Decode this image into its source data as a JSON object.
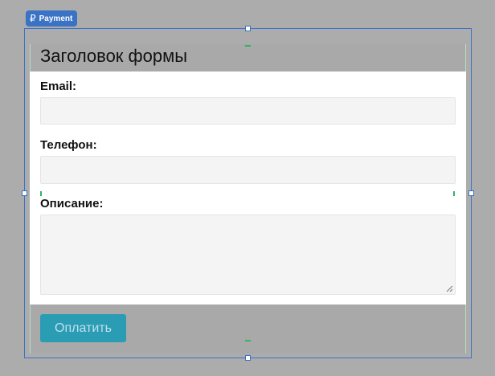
{
  "component": {
    "badge_label": "Payment",
    "badge_icon": "ruble-icon"
  },
  "form": {
    "title": "Заголовок формы",
    "fields": [
      {
        "label": "Email:",
        "value": "",
        "type": "text"
      },
      {
        "label": "Телефон:",
        "value": "",
        "type": "text"
      },
      {
        "label": "Описание:",
        "value": "",
        "type": "textarea"
      }
    ],
    "submit_label": "Оплатить"
  },
  "colors": {
    "selection": "#3a72c6",
    "button": "#2a9cb4",
    "guide": "#2fb463"
  }
}
